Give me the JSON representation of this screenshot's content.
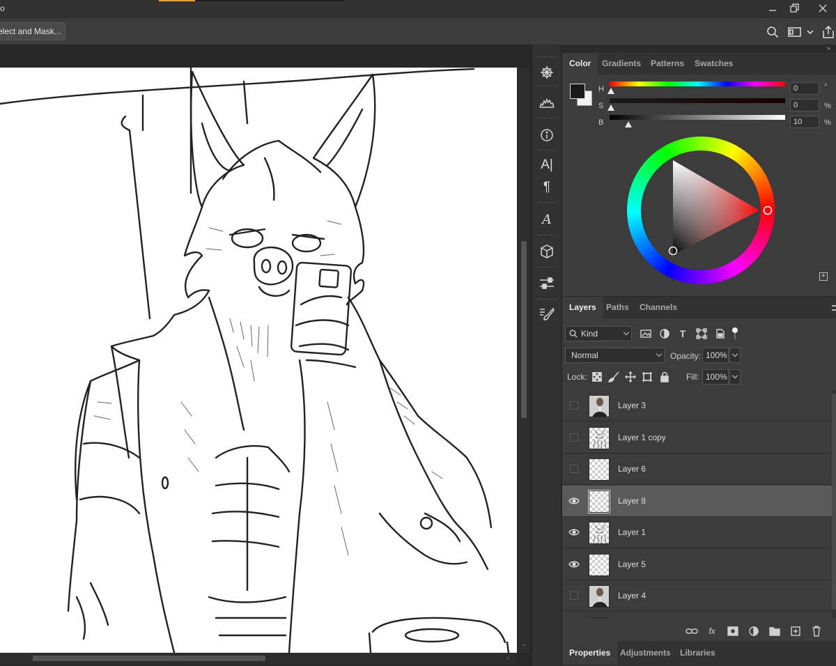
{
  "window": {
    "title_fragment": "o"
  },
  "options_bar": {
    "select_and_mask_label": "elect and Mask..."
  },
  "color_panel": {
    "tabs": [
      "Color",
      "Gradients",
      "Patterns",
      "Swatches"
    ],
    "active_tab": "Color",
    "sliders": [
      {
        "label": "H",
        "value": "0",
        "unit": "°"
      },
      {
        "label": "S",
        "value": "0",
        "unit": "%"
      },
      {
        "label": "B",
        "value": "10",
        "unit": "%"
      }
    ],
    "foreground_color": "#1a1a1a",
    "background_color": "#f2f2f2"
  },
  "layers_panel": {
    "tabs": [
      "Layers",
      "Paths",
      "Channels"
    ],
    "active_tab": "Layers",
    "filter_kind": "Kind",
    "blend_mode": "Normal",
    "opacity_label": "Opacity:",
    "opacity_value": "100%",
    "lock_label": "Lock:",
    "fill_label": "Fill:",
    "fill_value": "100%",
    "layers": [
      {
        "name": "Layer 3",
        "visible": false,
        "selected": false,
        "thumb": "photo"
      },
      {
        "name": "Layer 1 copy",
        "visible": false,
        "selected": false,
        "thumb": "sketch"
      },
      {
        "name": "Layer 6",
        "visible": false,
        "selected": false,
        "thumb": "empty"
      },
      {
        "name": "Layer 8",
        "visible": true,
        "selected": true,
        "thumb": "empty"
      },
      {
        "name": "Layer 1",
        "visible": true,
        "selected": false,
        "thumb": "sketch"
      },
      {
        "name": "Layer 5",
        "visible": true,
        "selected": false,
        "thumb": "empty"
      },
      {
        "name": "Layer 4",
        "visible": false,
        "selected": false,
        "thumb": "photo"
      }
    ]
  },
  "properties_panel": {
    "tabs": [
      "Properties",
      "Adjustments",
      "Libraries"
    ],
    "active_tab": "Properties"
  },
  "tool_icons": [
    "navigator-icon",
    "histogram-icon",
    "info-icon",
    "character-icon",
    "paragraph-icon",
    "glyphs-icon",
    "3d-icon",
    "adjust-icon",
    "brush-settings-icon"
  ],
  "accent_color": "#e8a33c"
}
